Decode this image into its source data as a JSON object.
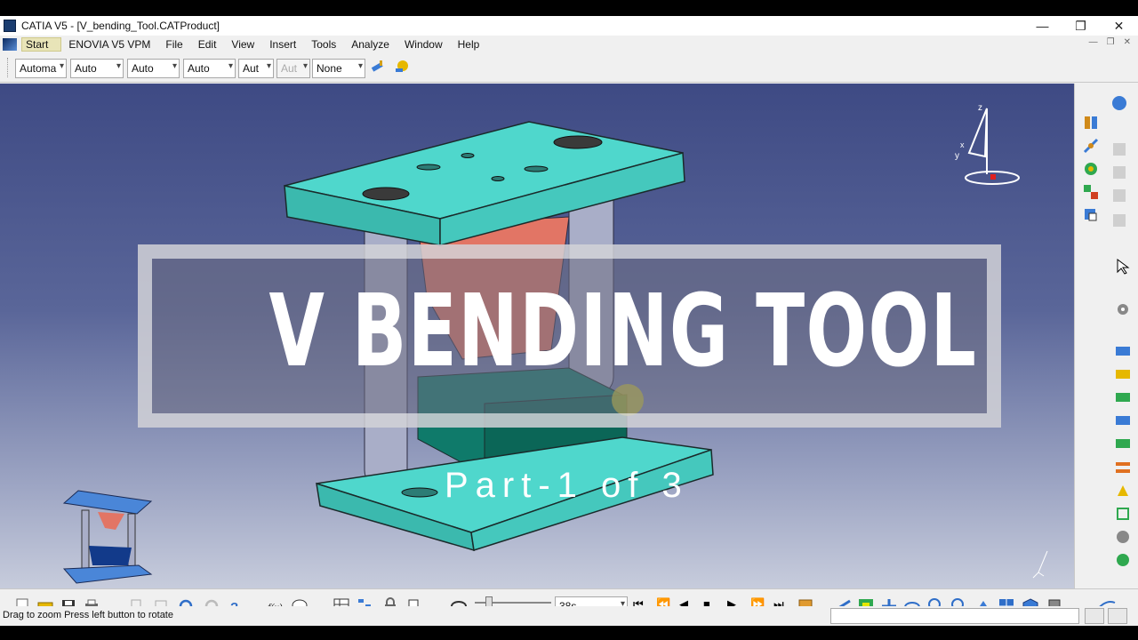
{
  "window": {
    "title": "CATIA V5 - [V_bending_Tool.CATProduct]",
    "controls": {
      "minimize": "—",
      "restore": "❐",
      "close": "✕"
    }
  },
  "menu": {
    "items": [
      "Start",
      "ENOVIA V5 VPM",
      "File",
      "Edit",
      "View",
      "Insert",
      "Tools",
      "Analyze",
      "Window",
      "Help"
    ]
  },
  "toolbar": {
    "combos": [
      "Automa",
      "Auto",
      "Auto",
      "Auto",
      "Aut",
      "Aut",
      "None"
    ]
  },
  "overlay": {
    "title": "V BENDING TOOL",
    "subtitle": "Part-1 of 3"
  },
  "animation": {
    "time_value": "38s"
  },
  "status": {
    "message": "Drag to zoom  Press left button to rotate"
  },
  "colors": {
    "plate": "#4fd7cc",
    "punch": "#e27565",
    "die": "#0f7a6a",
    "pillar": "#a9aec8",
    "background_top": "#3e4a84",
    "background_bottom": "#c7ccdc"
  },
  "icons": {
    "compass": "compass-icon",
    "axis": "axis-icon",
    "tree_preview": "product-thumbnail"
  }
}
